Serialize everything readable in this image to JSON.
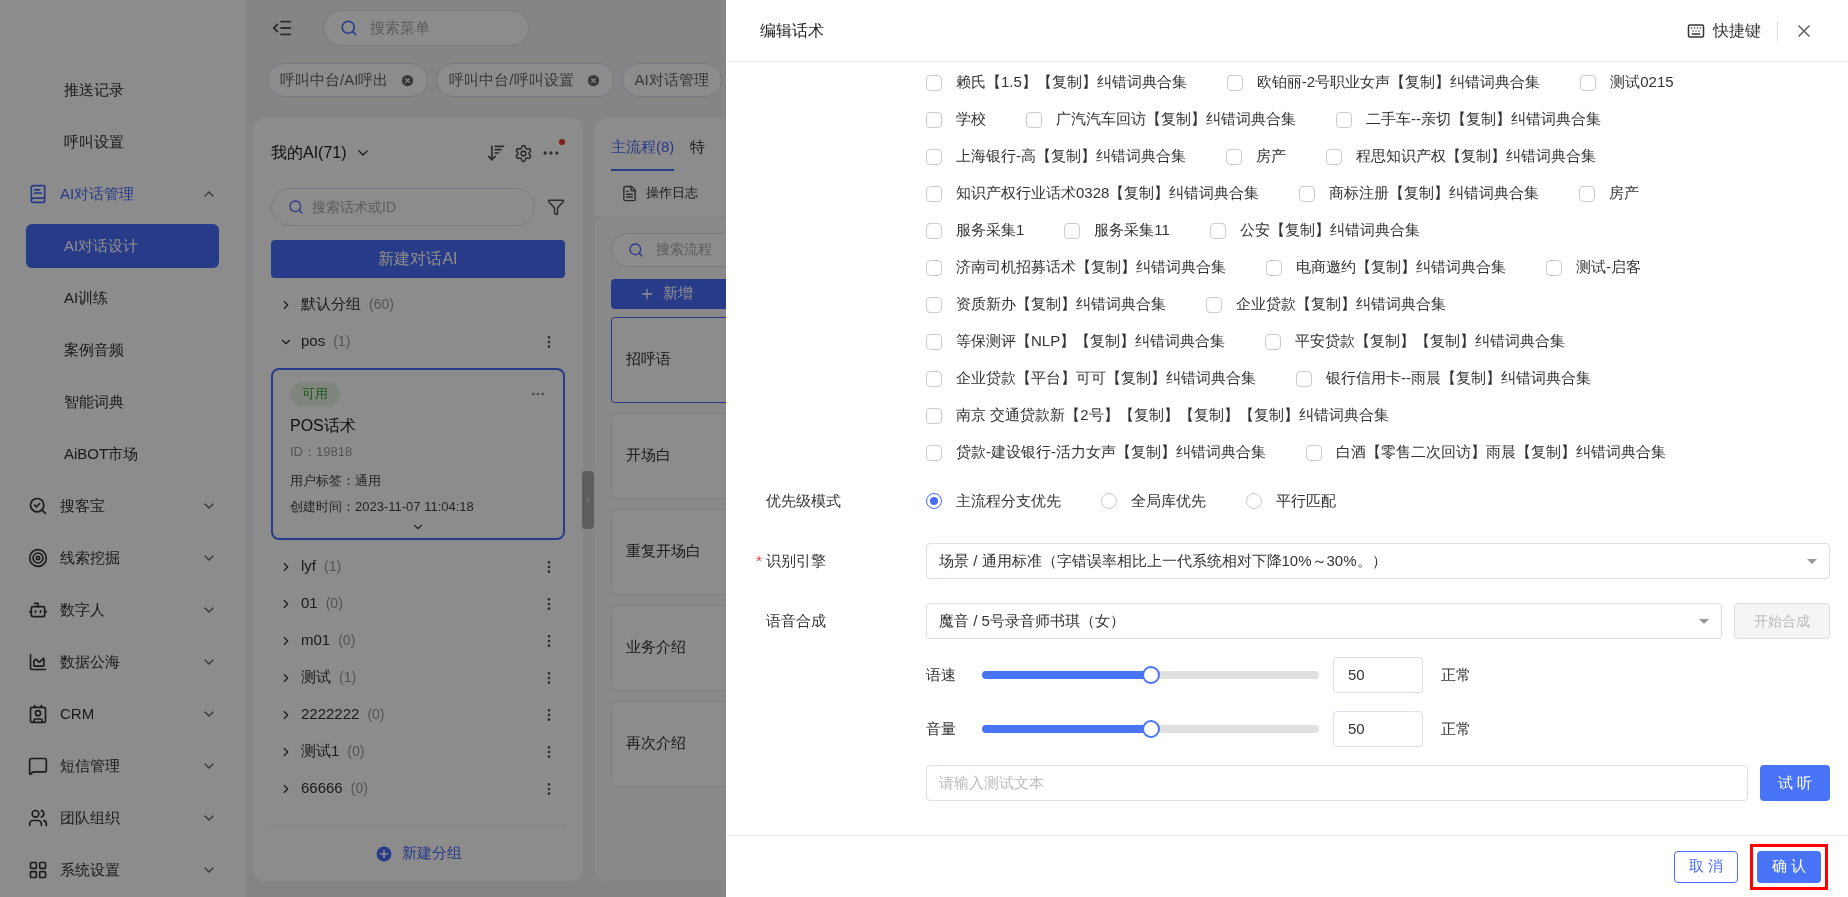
{
  "sidebar": {
    "items": [
      {
        "label": "推送记录"
      },
      {
        "label": "呼叫设置"
      },
      {
        "label": "AI对话管理",
        "expanded": true,
        "children": [
          {
            "label": "AI对话设计",
            "selected": true
          },
          {
            "label": "AI训练",
            "selected": false
          },
          {
            "label": "案例音频",
            "selected": false
          },
          {
            "label": "智能词典",
            "selected": false
          },
          {
            "label": "AiBOT市场",
            "selected": false
          }
        ]
      },
      {
        "label": "搜客宝",
        "expanded": false
      },
      {
        "label": "线索挖掘",
        "expanded": false
      },
      {
        "label": "数字人",
        "expanded": false
      },
      {
        "label": "数据公海",
        "expanded": false
      },
      {
        "label": "CRM",
        "expanded": false
      },
      {
        "label": "短信管理",
        "expanded": false
      },
      {
        "label": "团队组织",
        "expanded": false
      },
      {
        "label": "系统设置",
        "expanded": false
      }
    ]
  },
  "header": {
    "search_placeholder": "搜索菜单"
  },
  "page_tabs": [
    {
      "label": "呼叫中台/AI呼出",
      "closable": true
    },
    {
      "label": "呼叫中台/呼叫设置",
      "closable": true
    },
    {
      "label": "AI对话管理",
      "closable": false
    }
  ],
  "ai_panel": {
    "title": "我的AI(71)",
    "search_placeholder": "搜索话术或ID",
    "new_button": "新建对话AI",
    "groups": [
      {
        "name": "默认分组",
        "count": "(60)",
        "expanded": false,
        "menu": false
      },
      {
        "name": "pos",
        "count": "(1)",
        "expanded": true,
        "menu": true,
        "cards": [
          {
            "tag": "可用",
            "title": "POS话术",
            "id": "ID：19818",
            "user_tag": "用户标签：通用",
            "created": "创建时间：2023-11-07 11:04:18",
            "selected": true
          }
        ]
      },
      {
        "name": "lyf",
        "count": "(1)",
        "expanded": false,
        "menu": true
      },
      {
        "name": "01",
        "count": "(0)",
        "expanded": false,
        "menu": true
      },
      {
        "name": "m01",
        "count": "(0)",
        "expanded": false,
        "menu": true
      },
      {
        "name": "测试",
        "count": "(1)",
        "expanded": false,
        "menu": true
      },
      {
        "name": "2222222",
        "count": "(0)",
        "expanded": false,
        "menu": true
      },
      {
        "name": "测试1",
        "count": "(0)",
        "expanded": false,
        "menu": true
      },
      {
        "name": "66666",
        "count": "(0)",
        "expanded": false,
        "menu": true
      }
    ],
    "footer_button": "新建分组"
  },
  "flow_panel": {
    "tabs": [
      {
        "label": "主流程(8)",
        "selected": true
      },
      {
        "label": "特",
        "selected": false
      }
    ],
    "log_button": "操作日志",
    "search_placeholder": "搜索流程",
    "add_button": "新增",
    "nodes": [
      {
        "label": "招呼语",
        "selected": true
      },
      {
        "label": "开场白",
        "selected": false
      },
      {
        "label": "重复开场白",
        "selected": false
      },
      {
        "label": "业务介绍",
        "selected": false
      },
      {
        "label": "再次介绍",
        "selected": false
      }
    ]
  },
  "modal": {
    "title": "编辑话术",
    "shortcut": "快捷键",
    "dictionary_rows": [
      [
        {
          "label": "赖氏【1.5】【复制】纠错词典合集",
          "checked": false
        },
        {
          "label": "欧铂丽-2号职业女声【复制】纠错词典合集",
          "checked": false
        },
        {
          "label": "测试0215",
          "checked": false
        }
      ],
      [
        {
          "label": "学校",
          "checked": false
        },
        {
          "label": "广汽汽车回访【复制】纠错词典合集",
          "checked": false
        },
        {
          "label": "二手车--亲切【复制】纠错词典合集",
          "checked": false
        }
      ],
      [
        {
          "label": "上海银行-高【复制】纠错词典合集",
          "checked": false
        },
        {
          "label": "房产",
          "checked": false
        },
        {
          "label": "程思知识产权【复制】纠错词典合集",
          "checked": false
        }
      ],
      [
        {
          "label": "知识产权行业话术0328【复制】纠错词典合集",
          "checked": false
        },
        {
          "label": "商标注册【复制】纠错词典合集",
          "checked": false
        },
        {
          "label": "房产",
          "checked": false
        }
      ],
      [
        {
          "label": "服务采集1",
          "checked": false
        },
        {
          "label": "服务采集11",
          "checked": false
        },
        {
          "label": "公安【复制】纠错词典合集",
          "checked": false
        }
      ],
      [
        {
          "label": "济南司机招募话术【复制】纠错词典合集",
          "checked": false
        },
        {
          "label": "电商邀约【复制】纠错词典合集",
          "checked": false
        },
        {
          "label": "测试-启客",
          "checked": false
        }
      ],
      [
        {
          "label": "资质新办【复制】纠错词典合集",
          "checked": false
        },
        {
          "label": "企业贷款【复制】纠错词典合集",
          "checked": false
        }
      ],
      [
        {
          "label": "等保测评【NLP】【复制】纠错词典合集",
          "checked": false
        },
        {
          "label": "平安贷款【复制】【复制】纠错词典合集",
          "checked": false
        }
      ],
      [
        {
          "label": "企业贷款【平台】可可【复制】纠错词典合集",
          "checked": false
        },
        {
          "label": "银行信用卡--雨晨【复制】纠错词典合集",
          "checked": false
        }
      ],
      [
        {
          "label": "南京 交通贷款新【2号】【复制】【复制】【复制】纠错词典合集",
          "checked": false
        }
      ],
      [
        {
          "label": "贷款-建设银行-活力女声【复制】纠错词典合集",
          "checked": false
        },
        {
          "label": "白酒【零售二次回访】雨晨【复制】纠错词典合集",
          "checked": false
        }
      ]
    ],
    "priority": {
      "label": "优先级模式",
      "options": [
        {
          "label": "主流程分支优先",
          "selected": true
        },
        {
          "label": "全局库优先",
          "selected": false
        },
        {
          "label": "平行匹配",
          "selected": false
        }
      ]
    },
    "engine": {
      "label": "识别引擎",
      "required_mark": "*",
      "value": "场景 / 通用标准（字错误率相比上一代系统相对下降10%～30%。）"
    },
    "tts": {
      "label": "语音合成",
      "value": "魔音 / 5号录音师书琪（女）",
      "button": "开始合成",
      "button_disabled": true
    },
    "sliders": [
      {
        "label": "语速",
        "level": 0.5,
        "value": "50",
        "reading": "正常"
      },
      {
        "label": "音量",
        "level": 0.5,
        "value": "50",
        "reading": "正常"
      }
    ],
    "test": {
      "placeholder": "请输入测试文本",
      "button": "试 听"
    },
    "footer": {
      "cancel": "取 消",
      "confirm": "确 认",
      "confirm_highlighted": true
    }
  }
}
